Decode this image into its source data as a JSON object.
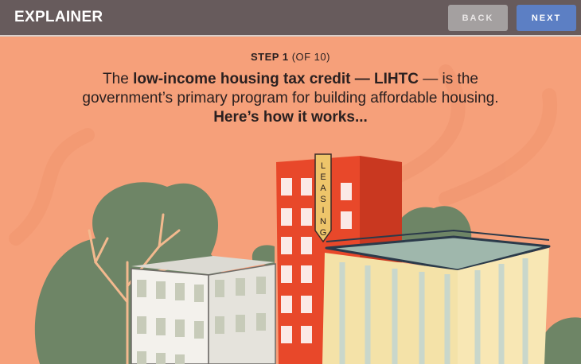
{
  "header": {
    "title": "EXPLAINER",
    "back_label": "BACK",
    "next_label": "NEXT"
  },
  "step": {
    "label": "STEP 1",
    "count": "(OF 10)"
  },
  "caption": {
    "pre": "The ",
    "bold": "low-income housing tax credit — LIHTC",
    "post": " — is the",
    "line2": "government’s primary program for building affordable housing.",
    "line3": "Here’s how it works..."
  },
  "illustration": {
    "sign_text": "LEASING",
    "colors": {
      "background": "#F6A07A",
      "red_building": "#E8482A",
      "glass_building": "#F4E2A8",
      "white_building": "#F3F1EC",
      "tree": "#6E8566",
      "sign": "#EEC56A"
    }
  }
}
